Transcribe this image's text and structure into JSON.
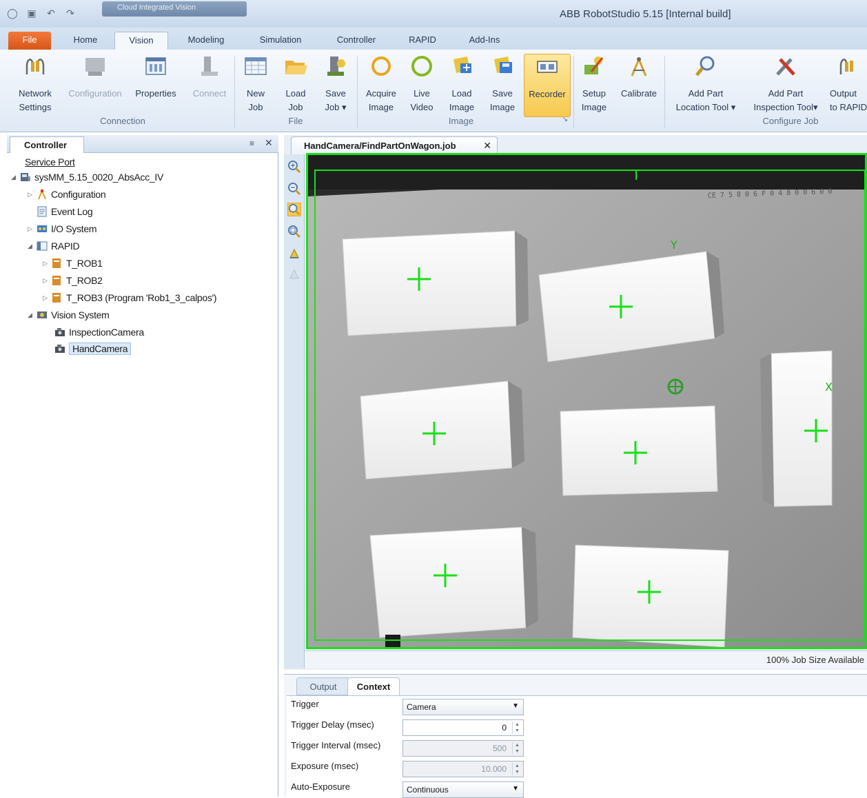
{
  "titlebar": {
    "app_title": "ABB RobotStudio 5.15 [Internal build]",
    "qat_title": "Cloud Integrated Vision"
  },
  "ribbon_tabs": [
    "File",
    "Home",
    "Vision",
    "Modeling",
    "Simulation",
    "Controller",
    "RAPID",
    "Add-Ins"
  ],
  "ribbon": {
    "network_settings": [
      "Network",
      "Settings"
    ],
    "configuration": "Configuration",
    "properties": "Properties",
    "connect": "Connect",
    "new_job": [
      "New",
      "Job"
    ],
    "load_job": [
      "Load",
      "Job"
    ],
    "save_job": [
      "Save",
      "Job ▾"
    ],
    "acquire_image": [
      "Acquire",
      "Image"
    ],
    "live_video": [
      "Live",
      "Video"
    ],
    "load_image": [
      "Load",
      "Image"
    ],
    "save_image": [
      "Save",
      "Image"
    ],
    "recorder": "Recorder",
    "setup_image": [
      "Setup",
      "Image"
    ],
    "calibrate": "Calibrate",
    "add_part_location": [
      "Add Part",
      "Location Tool ▾"
    ],
    "add_part_inspection": [
      "Add Part",
      "Inspection Tool▾"
    ],
    "output_to_rapid": [
      "Output",
      "to RAPID"
    ],
    "groups": {
      "connection": "Connection",
      "file": "File",
      "image": "Image",
      "configure_job": "Configure Job"
    }
  },
  "controller_panel": {
    "tab": "Controller",
    "pin": "≡",
    "close": "✕",
    "tree": {
      "service_port": "Service Port",
      "system": "sysMM_5.15_0020_AbsAcc_IV",
      "configuration": "Configuration",
      "event_log": "Event Log",
      "io_system": "I/O System",
      "rapid": "RAPID",
      "t_rob1": "T_ROB1",
      "t_rob2": "T_ROB2",
      "t_rob3": "T_ROB3 (Program 'Rob1_3_calpos')",
      "vision_system": "Vision System",
      "inspection_camera": "InspectionCamera",
      "hand_camera": "HandCamera"
    }
  },
  "document": {
    "tab_title": "HandCamera/FindPartOnWagon.job",
    "tab_close": "✕",
    "axis_y": "Y",
    "axis_x": "X",
    "job_size": "100% Job Size Available"
  },
  "bottom_pane": {
    "tabs": {
      "output": "Output",
      "context": "Context"
    },
    "fields": {
      "trigger": {
        "label": "Trigger",
        "value": "Camera"
      },
      "trigger_delay": {
        "label": "Trigger Delay (msec)",
        "value": "0"
      },
      "trigger_interval": {
        "label": "Trigger Interval (msec)",
        "value": "500"
      },
      "exposure": {
        "label": "Exposure (msec)",
        "value": "10.000"
      },
      "auto_exposure": {
        "label": "Auto-Exposure",
        "value": "Continuous"
      }
    }
  },
  "colors": {
    "overlay_green": "#18e018",
    "file_tab": "#e2621f",
    "recorder_active": "#f7c94e"
  }
}
